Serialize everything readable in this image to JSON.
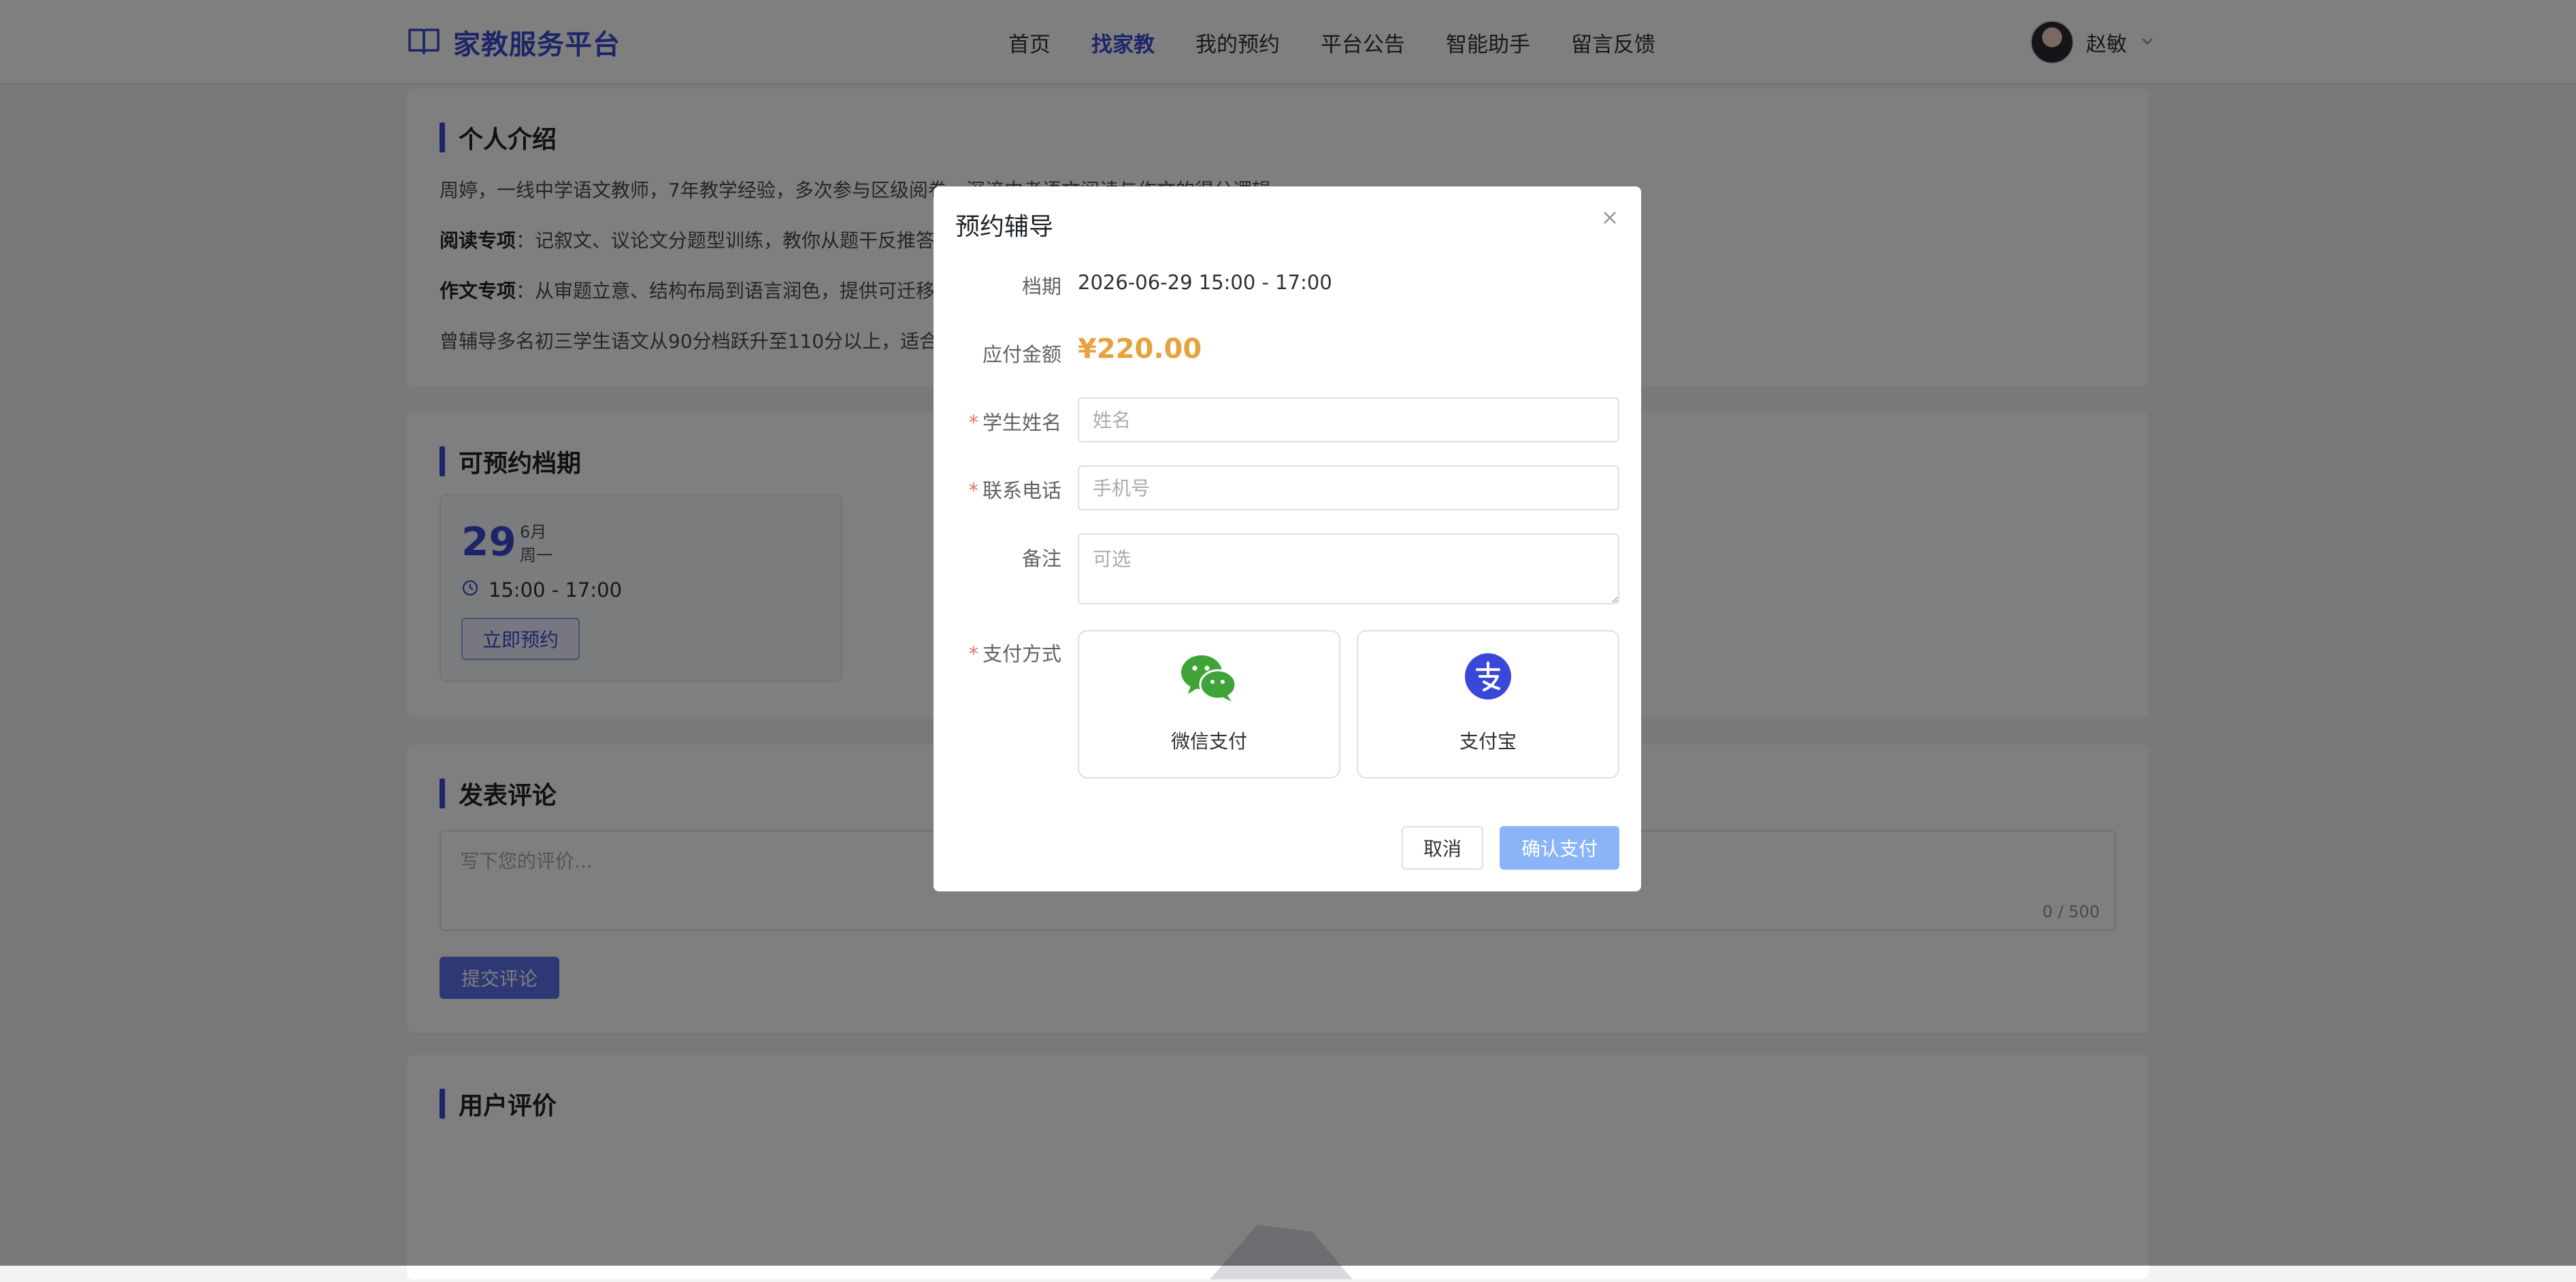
{
  "navbar": {
    "brand": "家教服务平台",
    "items": [
      {
        "label": "首页",
        "active": false
      },
      {
        "label": "找家教",
        "active": true
      },
      {
        "label": "我的预约",
        "active": false
      },
      {
        "label": "平台公告",
        "active": false
      },
      {
        "label": "智能助手",
        "active": false
      },
      {
        "label": "留言反馈",
        "active": false
      }
    ],
    "user_name": "赵敏"
  },
  "intro": {
    "title": "个人介绍",
    "line1": "周婷，一线中学语文教师，7年教学经验，多次参与区级阅卷，深谙中考语文阅读与作文的得分逻辑。",
    "line2_strong": "阅读专项",
    "line2_rest": "：记叙文、议论文分题型训练，教你从题干反推答案",
    "line3_strong": "作文专项",
    "line3_rest": "：从审题立意、结构布局到语言润色，提供可迁移",
    "line4": "曾辅导多名初三学生语文从90分档跃升至110分以上，适合有"
  },
  "slots": {
    "title": "可预约档期",
    "items": [
      {
        "day": "29",
        "month": "6月",
        "weekday": "周一",
        "time": "15:00 - 17:00",
        "button": "立即预约"
      }
    ]
  },
  "comment": {
    "title": "发表评论",
    "placeholder": "写下您的评价...",
    "count": "0 / 500",
    "submit": "提交评论"
  },
  "reviews": {
    "title": "用户评价"
  },
  "dialog": {
    "title": "预约辅导",
    "slot_label": "档期",
    "slot_value": "2026-06-29 15:00 - 17:00",
    "amount_label": "应付金额",
    "amount_value": "¥220.00",
    "student_label": "学生姓名",
    "student_placeholder": "姓名",
    "phone_label": "联系电话",
    "phone_placeholder": "手机号",
    "remark_label": "备注",
    "remark_placeholder": "可选",
    "pay_label": "支付方式",
    "pay_options": [
      {
        "label": "微信支付",
        "icon": "wechat-icon",
        "color": "#3fa438"
      },
      {
        "label": "支付宝",
        "icon": "alipay-icon",
        "color": "#3a48d8"
      }
    ],
    "cancel": "取消",
    "confirm": "确认支付"
  },
  "colors": {
    "accent": "#3a4bd0",
    "amount": "#e6a23c",
    "required": "#f56c6c",
    "confirm_button": "#8ab4f8"
  }
}
